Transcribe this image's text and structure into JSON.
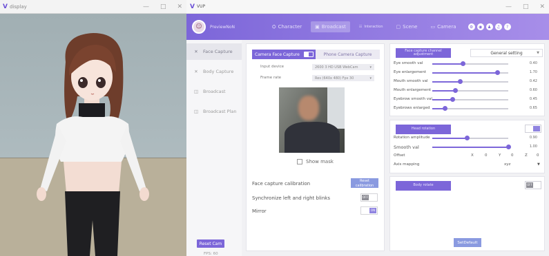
{
  "display_window": {
    "title": "display",
    "controls": [
      "—",
      "□",
      "✕"
    ]
  },
  "main_window": {
    "title": "VUP",
    "controls": [
      "—",
      "□",
      "✕"
    ]
  },
  "user": {
    "name": "PreviewNoN"
  },
  "tabs": [
    {
      "label": "Character",
      "icon": "⛭"
    },
    {
      "label": "Broadcast",
      "icon": "▣"
    },
    {
      "label": "Interaction",
      "icon": "☷"
    },
    {
      "label": "Scene",
      "icon": "▢"
    },
    {
      "label": "Camera",
      "icon": "▭"
    }
  ],
  "header_icons": [
    "⚙",
    "◉",
    "♟",
    "♫",
    "?"
  ],
  "side_menu": [
    {
      "label": "Face Capture",
      "icon": "✕"
    },
    {
      "label": "Body Capture",
      "icon": "✕"
    },
    {
      "label": "Broadcast",
      "icon": "◫"
    },
    {
      "label": "Broadcast Plan",
      "icon": "◫"
    }
  ],
  "reset_cam": "Reset Cam",
  "fps": "FPS: 60",
  "face_panel": {
    "camera_face_capture": "Camera Face Capture",
    "phone_camera_capture": "Phone Camera Capture",
    "input_device_label": "Input device",
    "input_device_value": "2600 3 HD USB WebCam",
    "frame_rate_label": "Frame rate",
    "frame_rate_value": "Res (640x 480)  Fps 30",
    "show_mask": "Show mask",
    "face_capture_calibration": "Face capture calibration",
    "reset_calibration": "Reset calibration",
    "sync_blinks": "Synchronize left and right blinks",
    "sync_toggle": "OFF",
    "mirror": "Mirror",
    "mirror_toggle": "ON"
  },
  "capture_panel": {
    "header": "Face capture channel adjustment",
    "general_setting": "General setting",
    "sliders": [
      {
        "label": "Eye smooth val",
        "value": "0.40",
        "fraction": 0.4
      },
      {
        "label": "Eye enlargement",
        "value": "1.70",
        "fraction": 0.85
      },
      {
        "label": "Mouth smooth val",
        "value": "0.42",
        "fraction": 0.36
      },
      {
        "label": "Mouth enlargement",
        "value": "0.60",
        "fraction": 0.3
      },
      {
        "label": "Eyebrow smooth val",
        "value": "0.45",
        "fraction": 0.26
      },
      {
        "label": "Eyebrows enlarged",
        "value": "0.65",
        "fraction": 0.16
      }
    ]
  },
  "head_panel": {
    "header": "Head rotation",
    "toggle": "ON",
    "sliders": [
      {
        "label": "Rotation amplitude",
        "value": "0.90",
        "fraction": 0.45
      },
      {
        "label": "Smooth val",
        "value": "1.00",
        "fraction": 1.0
      }
    ],
    "offset_label": "Offset",
    "offset": [
      {
        "axis": "X",
        "value": "0"
      },
      {
        "axis": "Y",
        "value": "0"
      },
      {
        "axis": "Z",
        "value": "0"
      }
    ],
    "axis_mapping_label": "Axis mapping",
    "axis_mapping_value": "xyz"
  },
  "body_panel": {
    "header": "Body rotate",
    "toggle": "OFF",
    "set_default": "SetDefault"
  },
  "colors": {
    "accent": "#7c66d9",
    "accent_light": "#8a9ae0"
  }
}
